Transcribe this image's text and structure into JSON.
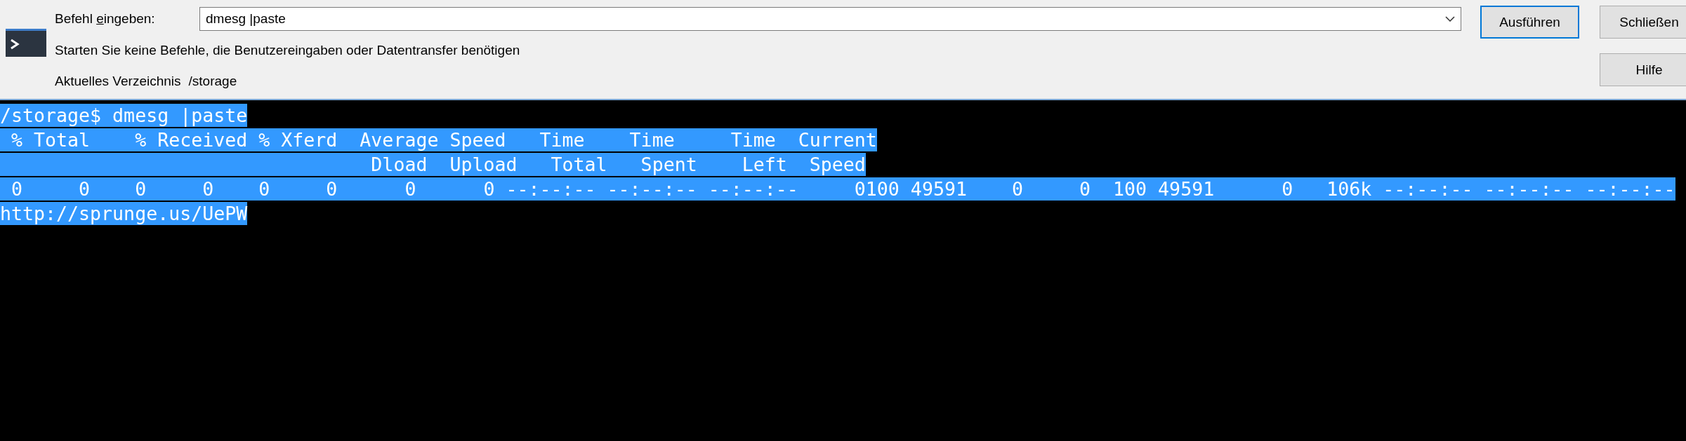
{
  "dialog": {
    "label_parts": [
      {
        "text": "Befehl ",
        "underlined": false
      },
      {
        "text": "e",
        "underlined": true
      },
      {
        "text": "ingeben:",
        "underlined": false
      }
    ],
    "command": "dmesg |paste",
    "warning": "Starten Sie keine Befehle, die Benutzereingaben oder Datentransfer benötigen",
    "directory_label": "Aktuelles Verzeichnis",
    "directory": "/storage",
    "buttons": [
      {
        "label": "Ausführen",
        "default": true
      },
      {
        "label": "Schließen",
        "default": false
      },
      {
        "label": "Hilfe",
        "default": false
      }
    ]
  },
  "terminal": {
    "lines": [
      {
        "text": "/storage$ dmesg |paste",
        "selected": true
      },
      {
        "text": " % Total    % Received % Xferd  Average Speed   Time    Time     Time  Current",
        "selected": true
      },
      {
        "text": "                                 Dload  Upload   Total   Spent    Left  Speed",
        "selected": true
      },
      {
        "text": " 0     0    0     0    0     0      0      0 --:--:-- --:--:-- --:--:--     0100 49591    0     0  100 49591      0   106k --:--:-- --:--:-- --:--:--",
        "selected": true
      },
      {
        "text": "http://sprunge.us/UePW",
        "selected": true
      }
    ]
  }
}
